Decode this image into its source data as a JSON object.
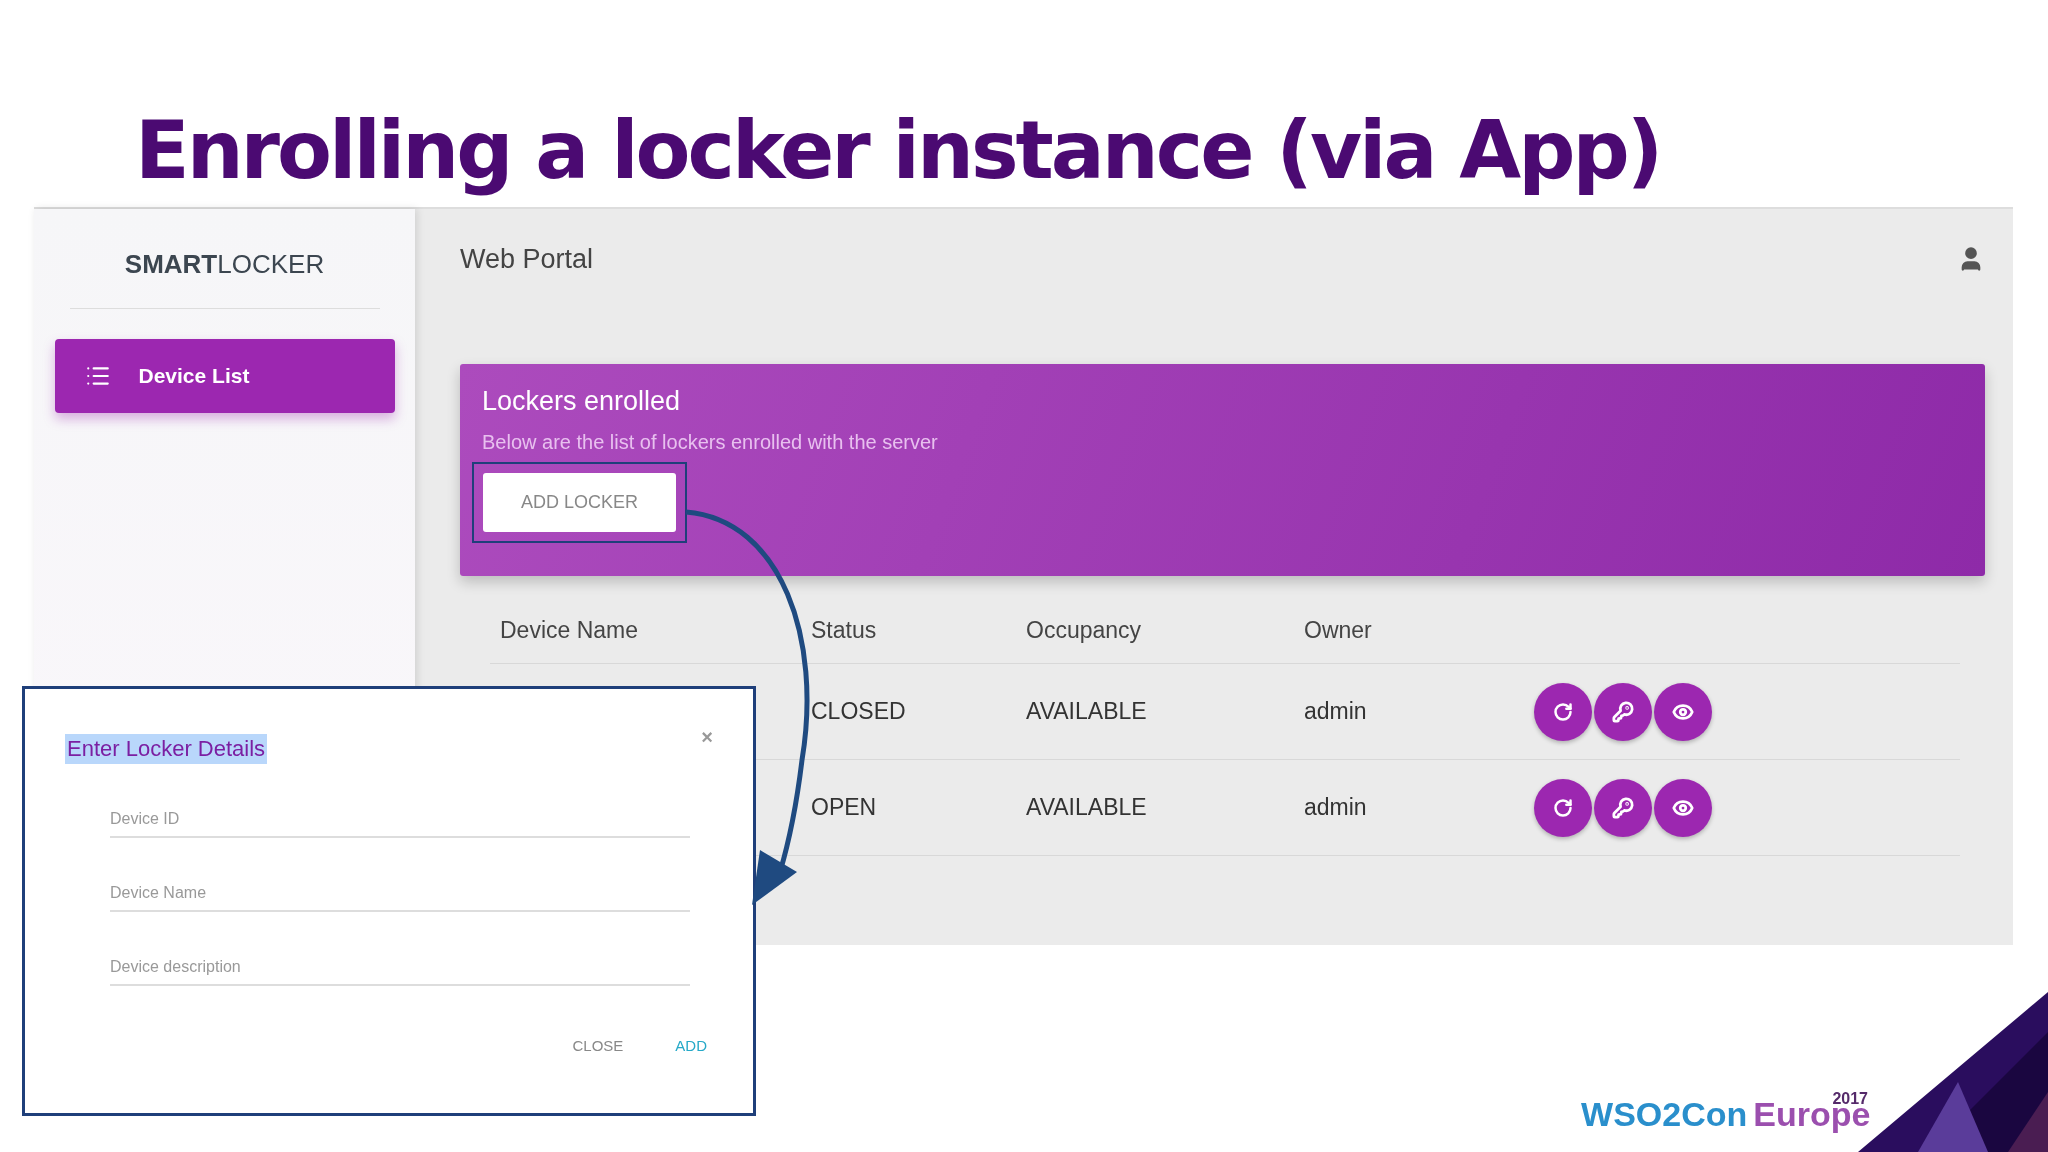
{
  "slide": {
    "title": "Enrolling a locker instance (via App)"
  },
  "app": {
    "brand": {
      "bold": "SMART",
      "light": "LOCKER"
    },
    "nav": [
      {
        "label": "Device List",
        "selected": true
      }
    ],
    "header": {
      "title": "Web Portal"
    },
    "card": {
      "title": "Lockers enrolled",
      "subtitle": "Below are the list of lockers enrolled with the server",
      "button": "ADD LOCKER",
      "highlighted": true
    },
    "table": {
      "columns": [
        "Device Name",
        "Status",
        "Occupancy",
        "Owner"
      ],
      "rows": [
        {
          "status": "CLOSED",
          "occupancy": "AVAILABLE",
          "owner": "admin"
        },
        {
          "status": "OPEN",
          "occupancy": "AVAILABLE",
          "owner": "admin"
        }
      ]
    }
  },
  "dialog": {
    "title": "Enter Locker Details",
    "title_selected": true,
    "close": "×",
    "fields": [
      {
        "placeholder": "Device ID"
      },
      {
        "placeholder": "Device Name"
      },
      {
        "placeholder": "Device description"
      }
    ],
    "buttons": [
      {
        "label": "CLOSE",
        "kind": "plain"
      },
      {
        "label": "ADD",
        "kind": "primary"
      }
    ]
  },
  "logo": {
    "words": [
      "WSO2Con",
      "Europe"
    ],
    "year": "2017"
  }
}
